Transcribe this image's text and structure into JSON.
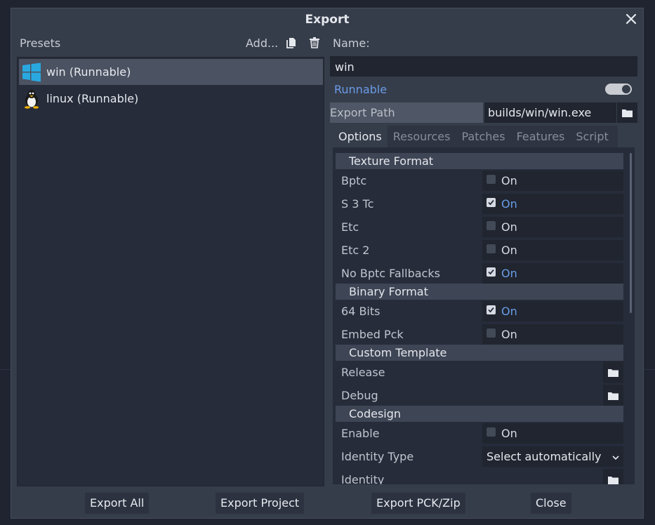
{
  "dialog": {
    "title": "Export",
    "close_icon": "close-icon"
  },
  "presets": {
    "label": "Presets",
    "add_label": "Add...",
    "items": [
      {
        "label": "win (Runnable)",
        "icon": "windows-icon",
        "selected": true
      },
      {
        "label": "linux (Runnable)",
        "icon": "linux-tux-icon",
        "selected": false
      }
    ]
  },
  "preset": {
    "name_label": "Name:",
    "name_value": "win",
    "runnable_label": "Runnable",
    "runnable_on": true,
    "export_path_label": "Export Path",
    "export_path_value": "builds/win/win.exe"
  },
  "tabs": [
    "Options",
    "Resources",
    "Patches",
    "Features",
    "Script"
  ],
  "options": {
    "sections": {
      "texture_format": "Texture Format",
      "binary_format": "Binary Format",
      "custom_template": "Custom Template",
      "codesign": "Codesign"
    },
    "on_text": "On",
    "rows": {
      "bptc": {
        "label": "Bptc",
        "checked": false
      },
      "s3tc": {
        "label": "S 3 Tc",
        "checked": true
      },
      "etc": {
        "label": "Etc",
        "checked": false
      },
      "etc2": {
        "label": "Etc 2",
        "checked": false
      },
      "no_bptc_fallbacks": {
        "label": "No Bptc Fallbacks",
        "checked": true
      },
      "bits64": {
        "label": "64 Bits",
        "checked": true
      },
      "embed_pck": {
        "label": "Embed Pck",
        "checked": false
      },
      "release": {
        "label": "Release"
      },
      "debug": {
        "label": "Debug"
      },
      "enable": {
        "label": "Enable",
        "checked": false
      },
      "identity_type": {
        "label": "Identity Type",
        "value": "Select automatically"
      },
      "identity": {
        "label": "Identity"
      }
    }
  },
  "footer": {
    "export_all": "Export All",
    "export_project": "Export Project",
    "export_pck_zip": "Export PCK/Zip",
    "close": "Close"
  },
  "colors": {
    "accent": "#699ce8",
    "dialog_bg": "#363d4a",
    "panel_bg": "#262c3a",
    "field_bg": "#20252f"
  }
}
